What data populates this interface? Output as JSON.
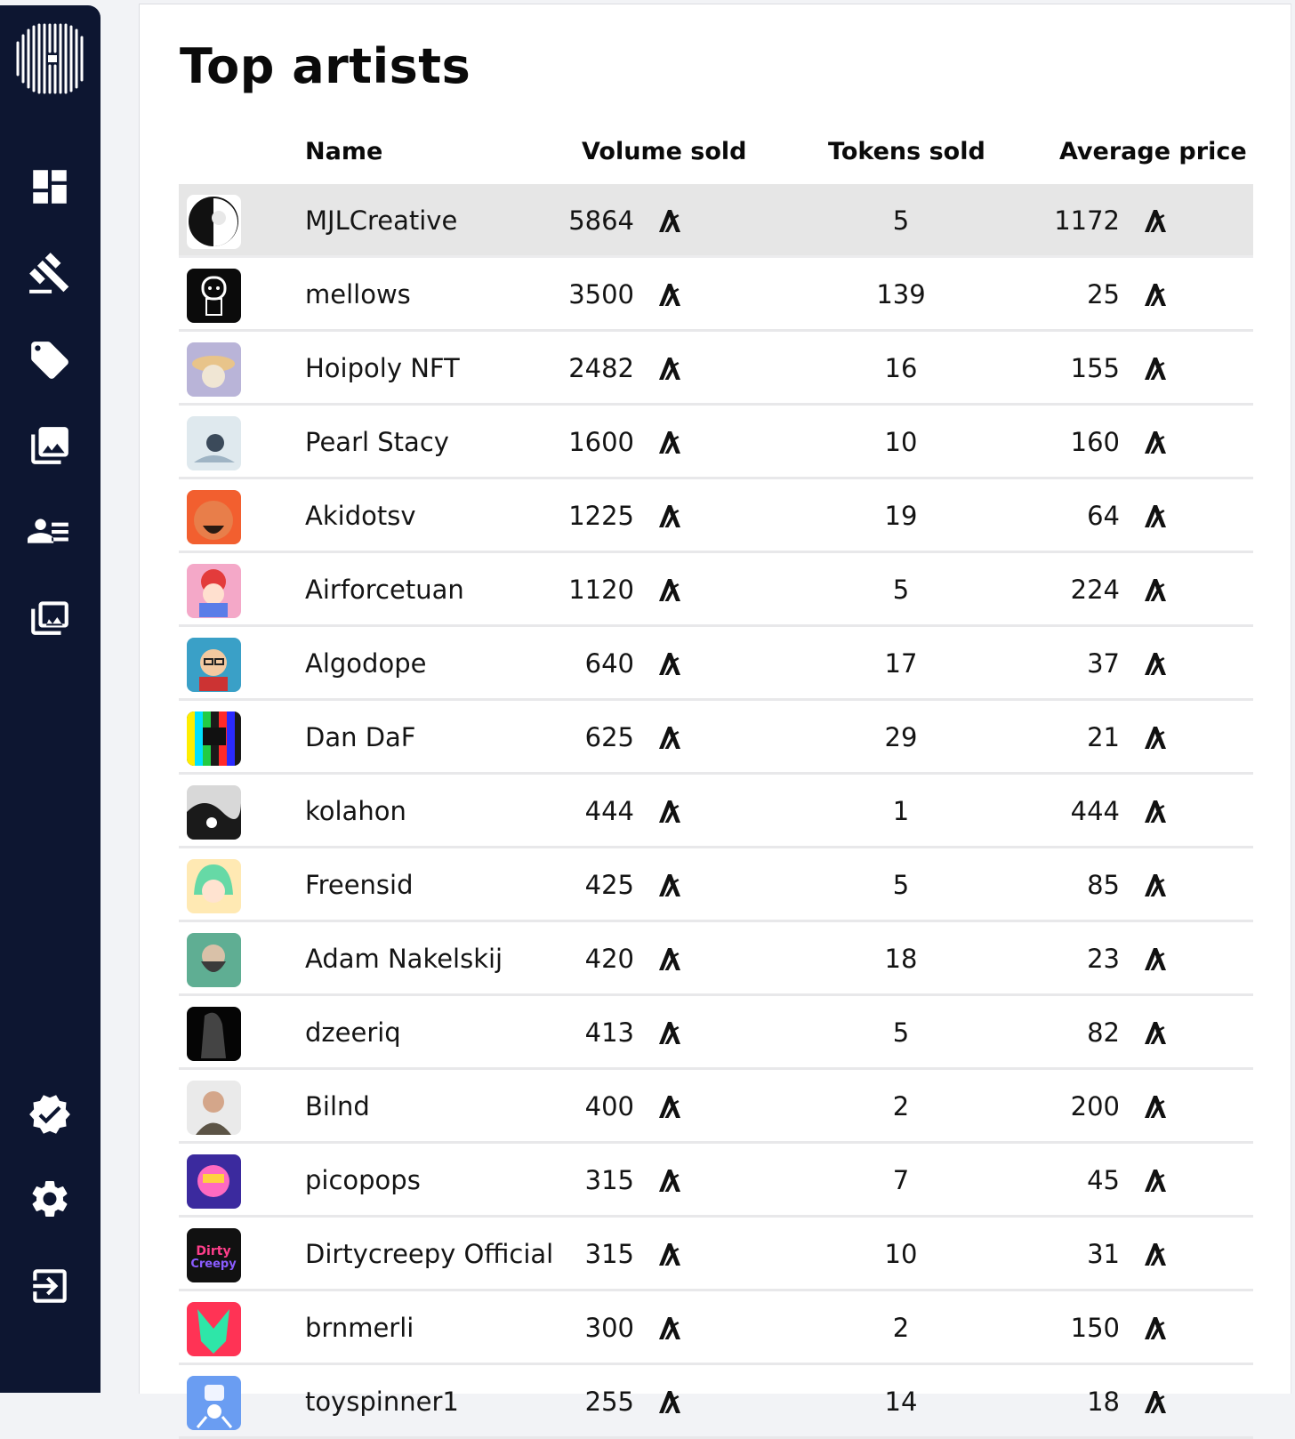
{
  "page": {
    "title": "Top artists"
  },
  "sidebar": {
    "logo": "logo-icon",
    "items": [
      {
        "icon": "dashboard-icon"
      },
      {
        "icon": "gavel-icon"
      },
      {
        "icon": "tag-icon"
      },
      {
        "icon": "gallery-icon"
      },
      {
        "icon": "artists-list-icon"
      },
      {
        "icon": "collections-icon"
      }
    ],
    "bottom_items": [
      {
        "icon": "verified-badge-icon"
      },
      {
        "icon": "settings-gear-icon"
      },
      {
        "icon": "logout-icon"
      }
    ]
  },
  "table": {
    "headers": {
      "name": "Name",
      "volume": "Volume sold",
      "tokens": "Tokens sold",
      "average": "Average price"
    },
    "currency_icon": "algorand-icon",
    "rows": [
      {
        "name": "MJLCreative",
        "volume": "5864",
        "tokens": "5",
        "average": "1172",
        "avatar_color": "#ffffff",
        "avatar_accent": "#111111"
      },
      {
        "name": "mellows",
        "volume": "3500",
        "tokens": "139",
        "average": "25",
        "avatar_color": "#0b0b0b",
        "avatar_accent": "#ffffff"
      },
      {
        "name": "Hoipoly NFT",
        "volume": "2482",
        "tokens": "16",
        "average": "155",
        "avatar_color": "#b9b4d8",
        "avatar_accent": "#e8c48a"
      },
      {
        "name": "Pearl Stacy",
        "volume": "1600",
        "tokens": "10",
        "average": "160",
        "avatar_color": "#dfe9ee",
        "avatar_accent": "#3b4a5a"
      },
      {
        "name": "Akidotsv",
        "volume": "1225",
        "tokens": "19",
        "average": "64",
        "avatar_color": "#f25f2f",
        "avatar_accent": "#e87e4a"
      },
      {
        "name": "Airforcetuan",
        "volume": "1120",
        "tokens": "5",
        "average": "224",
        "avatar_color": "#f4a8c8",
        "avatar_accent": "#5a7de8"
      },
      {
        "name": "Algodope",
        "volume": "640",
        "tokens": "17",
        "average": "37",
        "avatar_color": "#3aa0c7",
        "avatar_accent": "#f3c9a0"
      },
      {
        "name": "Dan DaF",
        "volume": "625",
        "tokens": "29",
        "average": "21",
        "avatar_color": "#1a1a1a",
        "avatar_accent": "#ff2a2a"
      },
      {
        "name": "kolahon",
        "volume": "444",
        "tokens": "1",
        "average": "444",
        "avatar_color": "#d8d8d8",
        "avatar_accent": "#1a1a1a"
      },
      {
        "name": "Freensid",
        "volume": "425",
        "tokens": "5",
        "average": "85",
        "avatar_color": "#ffe9b3",
        "avatar_accent": "#66d9a6"
      },
      {
        "name": "Adam Nakelskij",
        "volume": "420",
        "tokens": "18",
        "average": "23",
        "avatar_color": "#5fae93",
        "avatar_accent": "#3b3b3b"
      },
      {
        "name": "dzeeriq",
        "volume": "413",
        "tokens": "5",
        "average": "82",
        "avatar_color": "#050505",
        "avatar_accent": "#444444"
      },
      {
        "name": "Bilnd",
        "volume": "400",
        "tokens": "2",
        "average": "200",
        "avatar_color": "#eaeaea",
        "avatar_accent": "#5c5446"
      },
      {
        "name": "picopops",
        "volume": "315",
        "tokens": "7",
        "average": "45",
        "avatar_color": "#3b2a9e",
        "avatar_accent": "#ff6ac1"
      },
      {
        "name": "Dirtycreepy Official",
        "volume": "315",
        "tokens": "10",
        "average": "31",
        "avatar_color": "#111111",
        "avatar_accent": "#ff3e8a"
      },
      {
        "name": "brnmerli",
        "volume": "300",
        "tokens": "2",
        "average": "150",
        "avatar_color": "#ff3355",
        "avatar_accent": "#2ee6a8"
      },
      {
        "name": "toyspinner1",
        "volume": "255",
        "tokens": "14",
        "average": "18",
        "avatar_color": "#6a9df2",
        "avatar_accent": "#f0f4ff"
      }
    ]
  }
}
